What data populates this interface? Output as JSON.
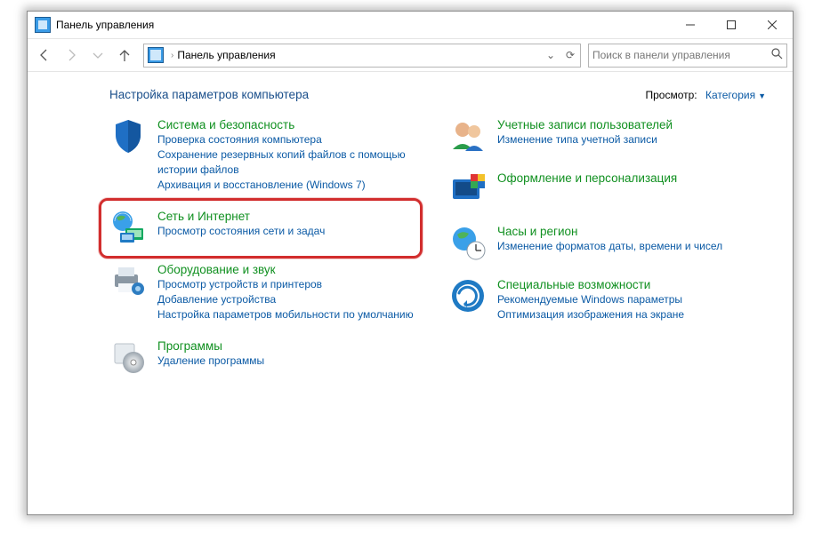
{
  "window": {
    "title": "Панель управления"
  },
  "nav": {
    "breadcrumb": "Панель управления",
    "search_placeholder": "Поиск в панели управления"
  },
  "header": {
    "heading": "Настройка параметров компьютера",
    "view_label": "Просмотр:",
    "view_value": "Категория"
  },
  "left": [
    {
      "id": "system-security",
      "title": "Система и безопасность",
      "links": [
        "Проверка состояния компьютера",
        "Сохранение резервных копий файлов с помощью истории файлов",
        "Архивация и восстановление (Windows 7)"
      ]
    },
    {
      "id": "network-internet",
      "title": "Сеть и Интернет",
      "links": [
        "Просмотр состояния сети и задач"
      ]
    },
    {
      "id": "hardware-sound",
      "title": "Оборудование и звук",
      "links": [
        "Просмотр устройств и принтеров",
        "Добавление устройства",
        "Настройка параметров мобильности по умолчанию"
      ]
    },
    {
      "id": "programs",
      "title": "Программы",
      "links": [
        "Удаление программы"
      ]
    }
  ],
  "right": [
    {
      "id": "user-accounts",
      "title": "Учетные записи пользователей",
      "links": [
        "Изменение типа учетной записи"
      ]
    },
    {
      "id": "appearance",
      "title": "Оформление и персонализация",
      "links": []
    },
    {
      "id": "clock-region",
      "title": "Часы и регион",
      "links": [
        "Изменение форматов даты, времени и чисел"
      ]
    },
    {
      "id": "ease-of-access",
      "title": "Специальные возможности",
      "links": [
        "Рекомендуемые Windows параметры",
        "Оптимизация изображения на экране"
      ]
    }
  ]
}
